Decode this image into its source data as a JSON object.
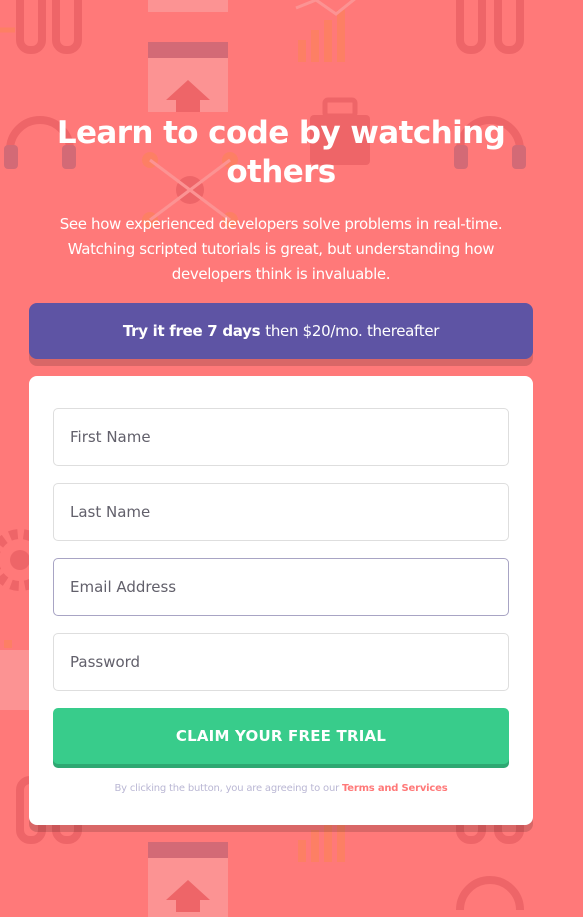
{
  "headline": "Learn to code by watching others",
  "subtext": "See how experienced developers solve problems in real-time. Watching scripted tutorials is great, but understanding how developers think is invaluable.",
  "trial_banner": {
    "bold": "Try it free 7 days",
    "rest": "then $20/mo. thereafter"
  },
  "form": {
    "first_name_placeholder": "First Name",
    "last_name_placeholder": "Last Name",
    "email_placeholder": "Email Address",
    "password_placeholder": "Password",
    "submit_label": "CLAIM YOUR FREE TRIAL"
  },
  "terms": {
    "prefix": "By clicking the button, you are agreeing to our",
    "link": "Terms and Services"
  },
  "colors": {
    "background": "#ff7979",
    "banner": "#5e54a4",
    "button": "#38cc8b",
    "text_muted": "#bab7d4"
  },
  "background_icons": [
    "link-icon",
    "bar-chart-icon",
    "browser-window-icon",
    "headset-icon",
    "briefcase-icon",
    "network-icon",
    "gear-icon",
    "upload-arrow-icon"
  ]
}
